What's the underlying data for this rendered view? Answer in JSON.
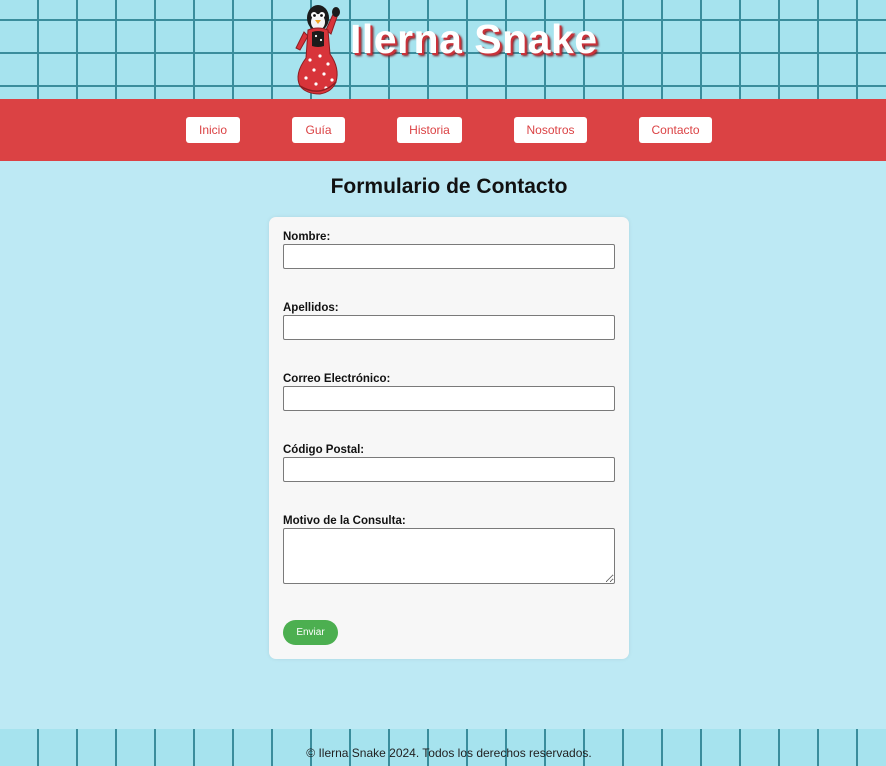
{
  "header": {
    "site_title": "Ilerna Snake",
    "mascot_icon": "penguin-flamenco-dancer-icon"
  },
  "nav": {
    "items": [
      {
        "label": "Inicio"
      },
      {
        "label": "Guía"
      },
      {
        "label": "Historia"
      },
      {
        "label": "Nosotros"
      },
      {
        "label": "Contacto"
      }
    ]
  },
  "main": {
    "page_title": "Formulario de Contacto",
    "form": {
      "fields": [
        {
          "label": "Nombre:",
          "value": ""
        },
        {
          "label": "Apellidos:",
          "value": ""
        },
        {
          "label": "Correo Electrónico:",
          "value": ""
        },
        {
          "label": "Código Postal:",
          "value": ""
        },
        {
          "label": "Motivo de la Consulta:",
          "value": ""
        }
      ],
      "submit_label": "Enviar"
    }
  },
  "footer": {
    "text": "© Ilerna Snake 2024. Todos los derechos reservados."
  },
  "colors": {
    "nav_red": "#db4244",
    "page_bg": "#bde9f4",
    "grid_line": "#3a8d9c",
    "submit_green": "#4caf50"
  }
}
